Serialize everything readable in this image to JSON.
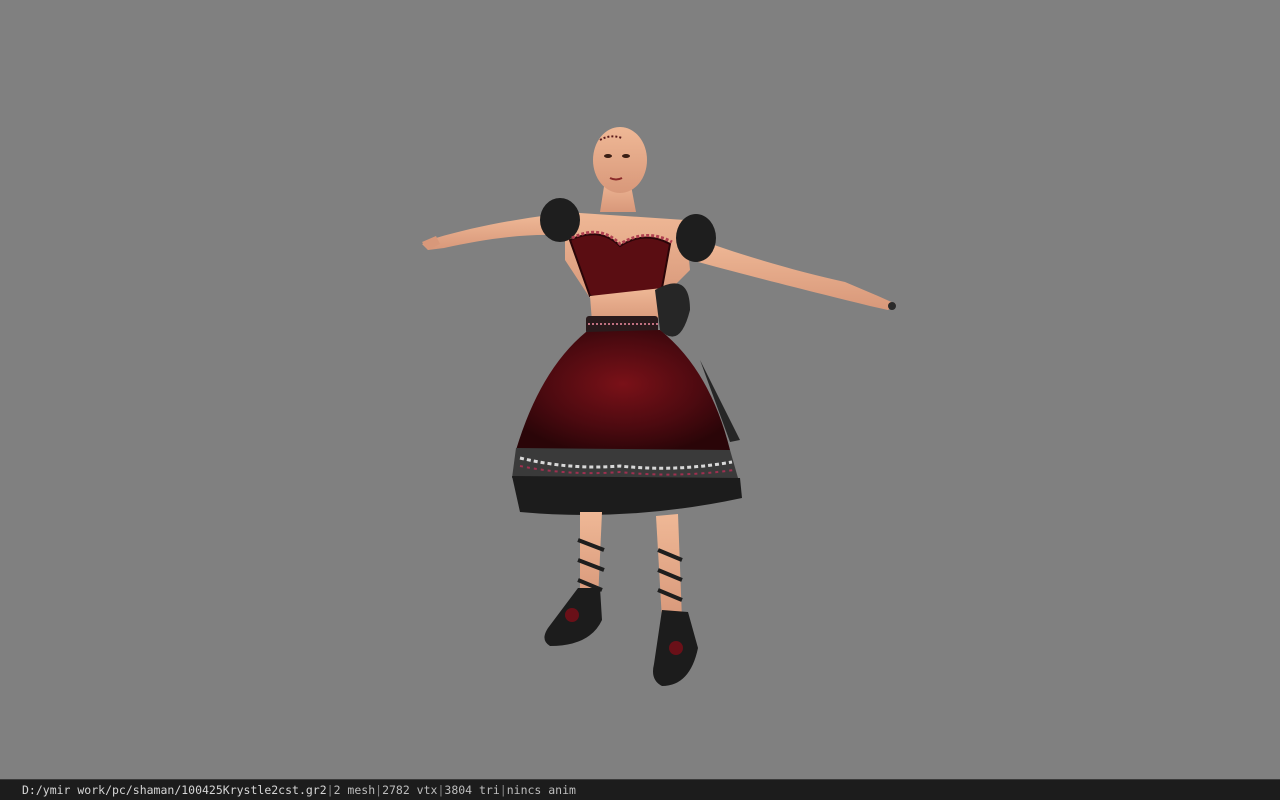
{
  "status_bar": {
    "file_path": "D:/ymir work/pc/shaman/100425Krystle2cst.gr2",
    "separator": "|",
    "mesh_count": "2 mesh",
    "vertex_count": "2782 vtx",
    "triangle_count": "3804 tri",
    "animation": "nincs anim"
  },
  "colors": {
    "viewport_background": "#808080",
    "status_bar_background": "#1c1c1c",
    "dress": "#5a0d12",
    "skin": "#e0a582"
  }
}
